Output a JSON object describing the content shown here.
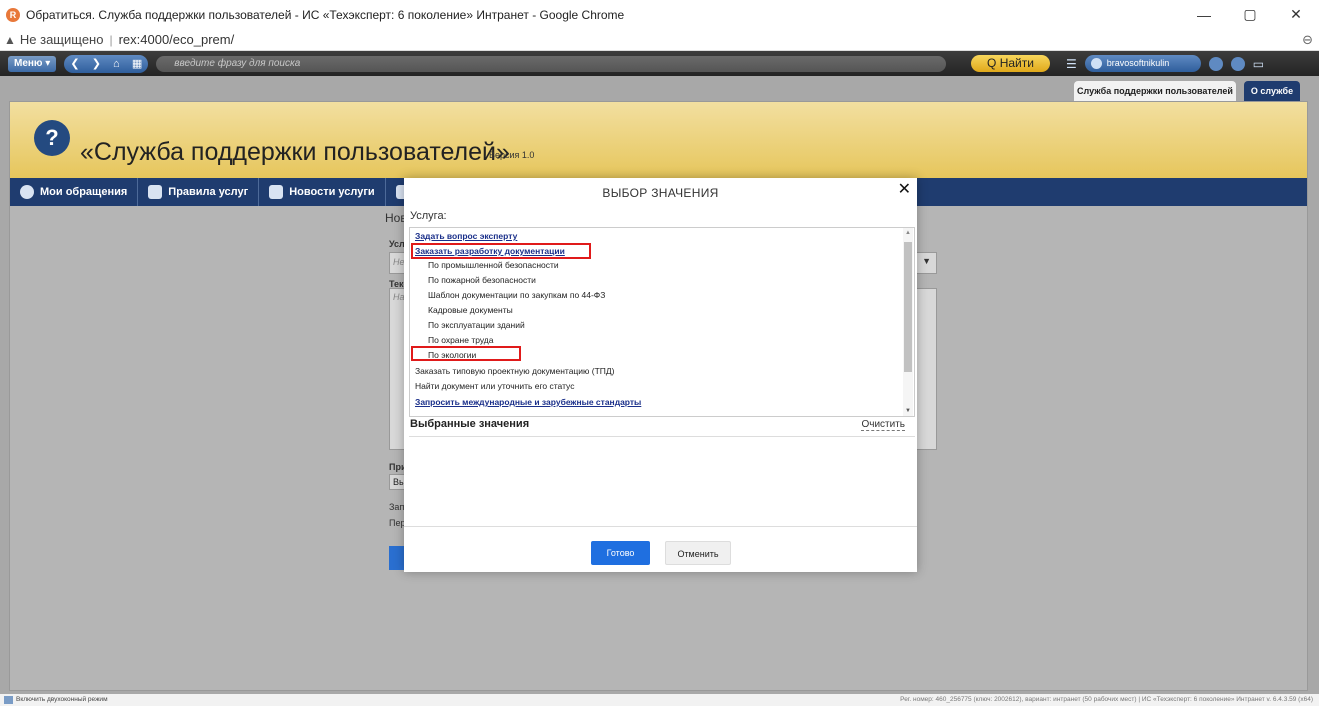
{
  "browser": {
    "title": "Обратиться. Служба поддержки пользователей - ИС «Техэксперт: 6 поколение» Интранет - Google Chrome",
    "insecure_label": "Не защищено",
    "url": "rex:4000/eco_prem/"
  },
  "toolbar": {
    "menu_label": "Меню ▾",
    "search_placeholder": "введите фразу для поиска",
    "find_label": "Q Найти",
    "user_name": "bravosoftnikulin"
  },
  "tabs": {
    "service_tab": "Служба поддержки пользователей",
    "about_tab": "О службе"
  },
  "app": {
    "title": "«Служба поддержки пользователей»",
    "version": "Версия 1.0",
    "nav": [
      {
        "label": "Мои обращения"
      },
      {
        "label": "Правила услуг"
      },
      {
        "label": "Новости услуги"
      }
    ]
  },
  "form": {
    "label_new": "Нов",
    "label_service": "Услу",
    "label_text": "Текс",
    "label_attach": "При",
    "label_button": "Вы",
    "label_request": "Зап",
    "label_per": "Пер",
    "placeholder_service": "Не",
    "placeholder_text": "На"
  },
  "modal": {
    "title": "ВЫБОР ЗНАЧЕНИЯ",
    "close": "✕",
    "field_label": "Услуга:",
    "items": [
      {
        "label": "Задать вопрос эксперту",
        "type": "link"
      },
      {
        "label": "Заказать разработку документации",
        "type": "link"
      },
      {
        "label": "По промышленной безопасности",
        "type": "sub"
      },
      {
        "label": "По пожарной безопасности",
        "type": "sub"
      },
      {
        "label": "Шаблон документации по закупкам по 44-ФЗ",
        "type": "sub"
      },
      {
        "label": "Кадровые документы",
        "type": "sub"
      },
      {
        "label": "По эксплуатации зданий",
        "type": "sub"
      },
      {
        "label": "По охране труда",
        "type": "sub"
      },
      {
        "label": "По экологии",
        "type": "sub"
      },
      {
        "label": "Заказать типовую проектную документацию (ТПД)",
        "type": "plain"
      },
      {
        "label": "Найти документ или уточнить его статус",
        "type": "plain"
      },
      {
        "label": "Запросить международные и зарубежные стандарты",
        "type": "link"
      }
    ],
    "selected_header": "Выбранные значения",
    "clear_label": "Очистить",
    "done_label": "Готово",
    "cancel_label": "Отменить"
  },
  "statusbar": {
    "left": "Включить двухоконный режим",
    "right": "Рег. номер: 460_256775 (ключ: 2002612), вариант: интранет (50 рабочих мест)  |  ИС «Техэксперт: 6 поколение» Интранет v. 6.4.3.59 (x64)"
  }
}
